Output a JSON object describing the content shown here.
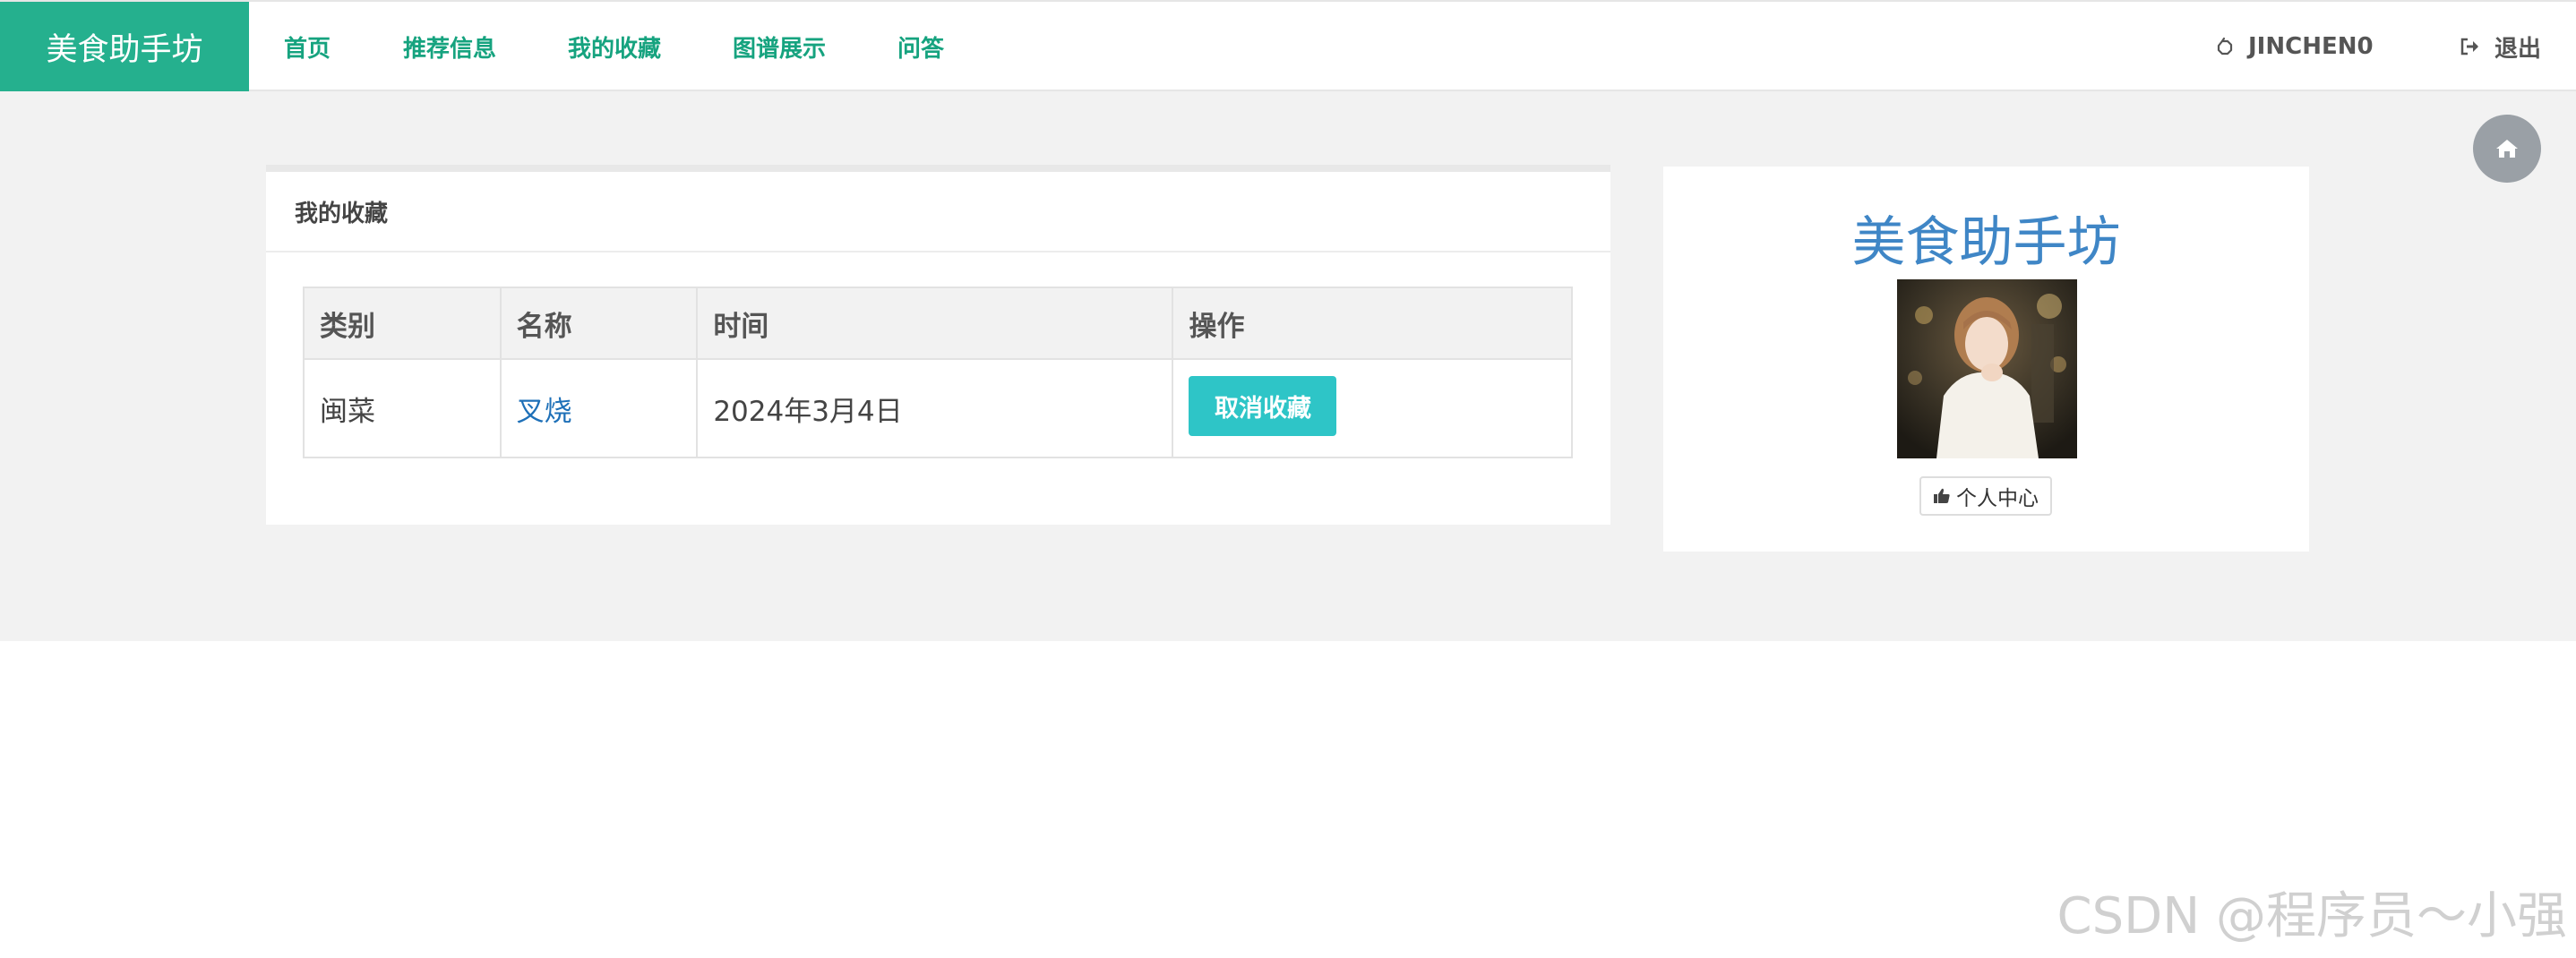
{
  "brand": {
    "title": "美食助手坊",
    "color": "#25b08e"
  },
  "nav": {
    "items": [
      {
        "label": "首页"
      },
      {
        "label": "推荐信息"
      },
      {
        "label": "我的收藏"
      },
      {
        "label": "图谱展示"
      },
      {
        "label": "问答"
      }
    ]
  },
  "user": {
    "username": "JINCHEN0",
    "user_icon": "hand-icon",
    "logout_label": "退出",
    "logout_icon": "sign-out-icon"
  },
  "favorites": {
    "title": "我的收藏",
    "columns": [
      "类别",
      "名称",
      "时间",
      "操作"
    ],
    "rows": [
      {
        "category": "闽菜",
        "name": "叉烧",
        "time": "2024年3月4日",
        "action": "取消收藏"
      }
    ],
    "action_color": "#2ec5c7"
  },
  "profile": {
    "site_title": "美食助手坊",
    "button_label": "个人中心",
    "button_icon": "thumbs-up-icon"
  },
  "home_button": {
    "icon": "home-icon"
  },
  "watermark": "CSDN @程序员～小强"
}
